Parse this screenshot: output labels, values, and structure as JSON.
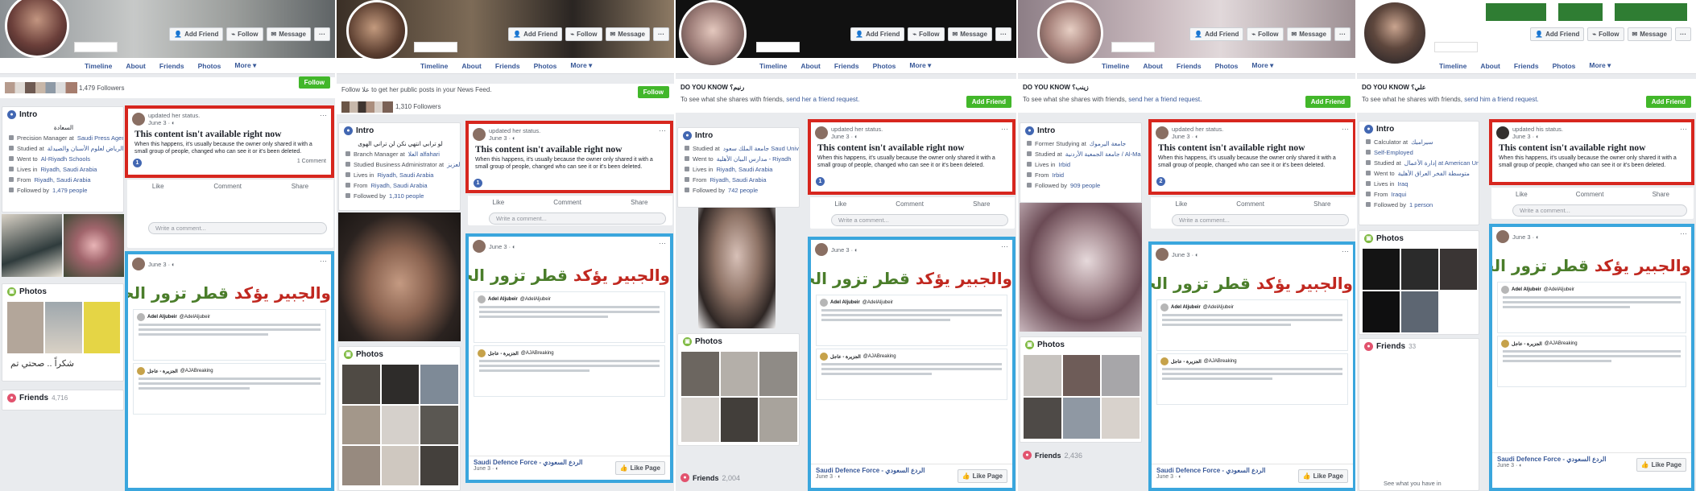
{
  "common": {
    "nav": [
      "Timeline",
      "About",
      "Friends",
      "Photos"
    ],
    "nav_more": "More ▾",
    "add_friend": "Add Friend",
    "follow": "Follow",
    "message": "Message",
    "more_dots": "···",
    "intro": "Intro",
    "photos": "Photos",
    "friends": "Friends",
    "updated_her": "updated her status.",
    "updated_his": "updated his status.",
    "date": "June 3 · ◐",
    "unavailable_title": "This content isn't available right now",
    "unavailable_body": "When this happens, it's usually because the owner only shared it with a small group of people, changed who can see it or it's been deleted.",
    "like": "Like",
    "comment": "Comment",
    "share": "Share",
    "write_comment": "Write a comment...",
    "banner_green": "قطر تزور الحقائق ..",
    "banner_red": "والجبير يؤكد",
    "page_name": "Saudi Defence Force - الردع السعودي",
    "like_page": "Like Page",
    "tweet_name": "Adel Aljubeir",
    "tweet_handle": "@AdelAljubeir",
    "tweet_name2": "الجزيرة - عاجل",
    "tweet_handle2": "@AJABreaking"
  },
  "p1": {
    "followers": "1,479 Followers",
    "follow_btn": "Follow",
    "arabic_intro": "السعادة",
    "intro": [
      [
        "Precision Manager at",
        "Saudi Press Agency وكالة الأنباء السعودية"
      ],
      [
        "Studied at",
        "الكلية الرياض لعلوم الأسنان والصيدلة"
      ],
      [
        "Went to",
        "Al-Riyadh Schools"
      ],
      [
        "Lives in",
        "Riyadh, Saudi Arabia"
      ],
      [
        "From",
        "Riyadh, Saudi Arabia"
      ],
      [
        "Followed by",
        "1,479 people"
      ]
    ],
    "comments": "1 Comment",
    "reactions": "1",
    "friends_count": "4,716",
    "signature": "شكراً .. صحتي تم"
  },
  "p2": {
    "follow_text": "Follow علا to get her public posts in your News Feed.",
    "followed": "1,310 Followers",
    "follow_btn": "Follow",
    "arabic_intro": "لو ترابي انتهي نكن لن تراني الهوى",
    "intro": [
      [
        "Branch Manager at",
        "العلا alfahari"
      ],
      [
        "Studied Business Administrator at",
        "جامعة الملك عبد العزيز - Al Hamdah University"
      ],
      [
        "Lives in",
        "Riyadh, Saudi Arabia"
      ],
      [
        "From",
        "Riyadh, Saudi Arabia"
      ],
      [
        "Followed by",
        "1,310 people"
      ]
    ],
    "reactions": "1"
  },
  "p3": {
    "dyk": "DO YOU KNOW رنيم؟",
    "see_text": "To see what she shares with friends,",
    "see_link": "send her a friend request.",
    "intro": [
      [
        "Studied at",
        "جامعة الملك سعود Saud University"
      ],
      [
        "Went to",
        "مدارس البيان الأهلية - Riyadh"
      ],
      [
        "Lives in",
        "Riyadh, Saudi Arabia"
      ],
      [
        "From",
        "Riyadh, Saudi Arabia"
      ],
      [
        "Followed by",
        "742 people"
      ]
    ],
    "reactions": "1",
    "friends_count": "2,004"
  },
  "p4": {
    "dyk": "DO YOU KNOW زينب؟",
    "see_text": "To see what she shares with friends,",
    "see_link": "send her a friend request.",
    "intro": [
      [
        "Former Studying at",
        "جامعة اليرموك"
      ],
      [
        "Studied at",
        "جامعة الجمعية الأردنية / Al-Maha"
      ],
      [
        "Lives in",
        "Irbid"
      ],
      [
        "From",
        "Irbid"
      ],
      [
        "Followed by",
        "909 people"
      ]
    ],
    "reactions": "2",
    "friends_count": "2,436"
  },
  "p5": {
    "dyk": "DO YOU KNOW علي؟",
    "see_text": "To see what he shares with friends,",
    "see_link": "send him a friend request.",
    "intro": [
      [
        "Calculator at",
        "سيراميك"
      ],
      [
        "",
        "Self-Employed"
      ],
      [
        "Studied at",
        "إدارة الأعمال at American University of Iraq, Sulaimani"
      ],
      [
        "Went to",
        "متوسطة الفخر العراق الأهلية"
      ],
      [
        "Lives in",
        "Iraq"
      ],
      [
        "From",
        "Iraqui"
      ],
      [
        "Followed by",
        "1 person"
      ]
    ],
    "friends_count": "33",
    "see_have": "See what you have in"
  }
}
